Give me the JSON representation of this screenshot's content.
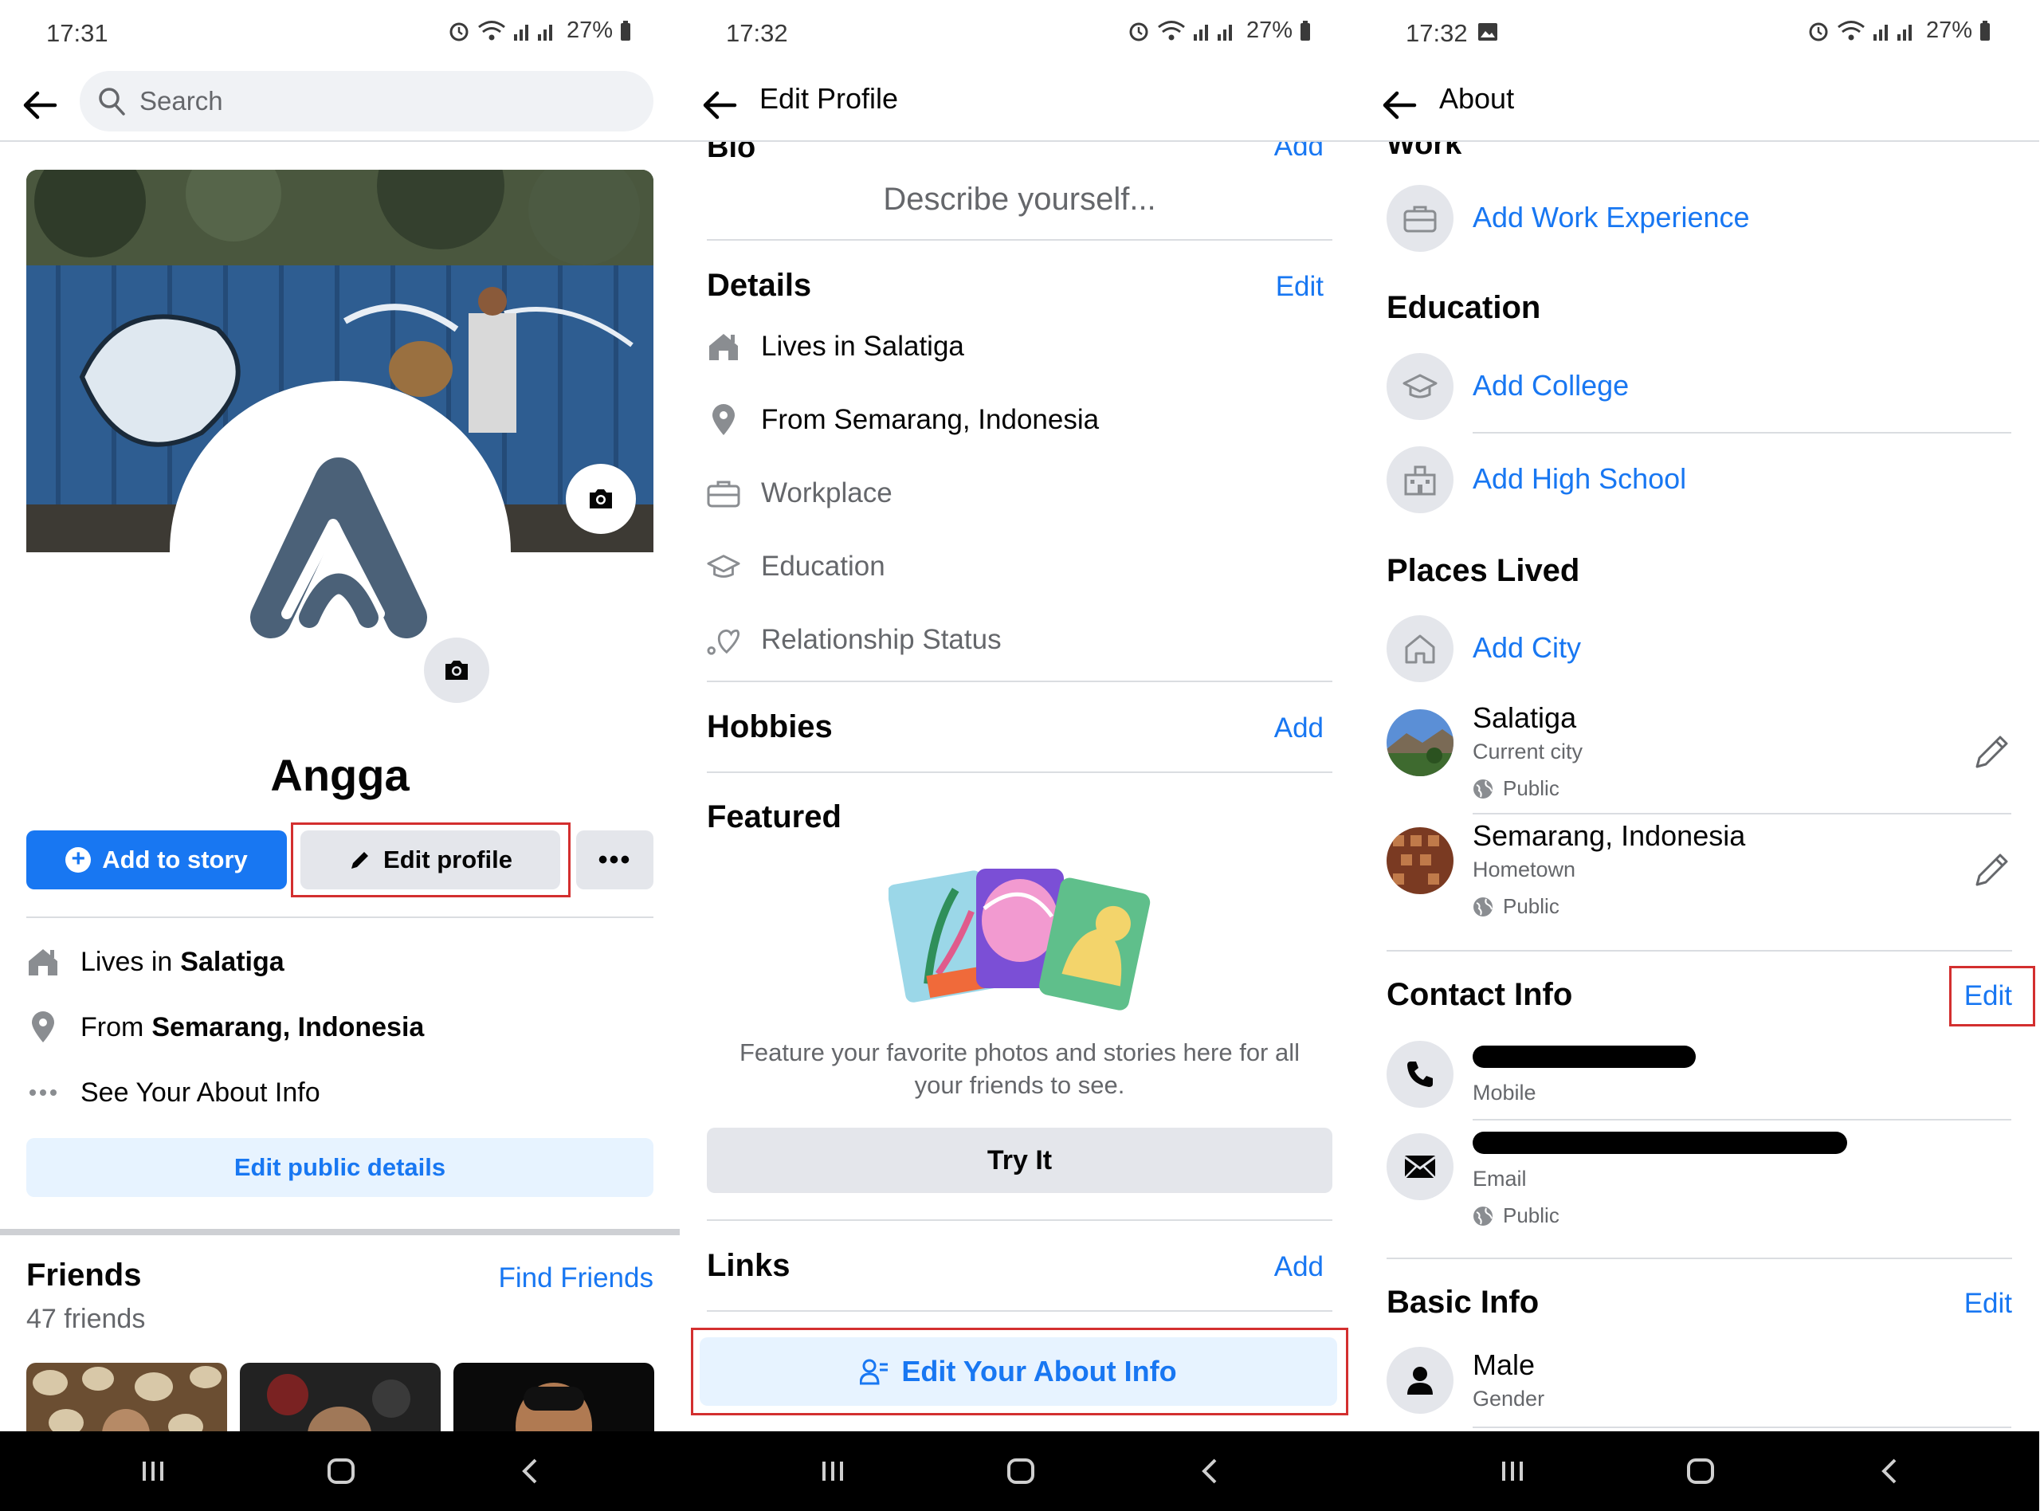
{
  "screen1": {
    "status_time": "17:31",
    "battery": "27%",
    "search_placeholder": "Search",
    "profile_name": "Angga",
    "add_story_label": "Add to story",
    "edit_profile_label": "Edit profile",
    "more_label": "•••",
    "lives_prefix": "Lives in",
    "lives_value": "Salatiga",
    "from_prefix": "From",
    "from_value": "Semarang, Indonesia",
    "see_about": "See Your About Info",
    "edit_public_details": "Edit public details",
    "friends_title": "Friends",
    "find_friends": "Find Friends",
    "friends_count": "47 friends"
  },
  "screen2": {
    "status_time": "17:32",
    "battery": "27%",
    "title": "Edit Profile",
    "bio_cut_title": "Bio",
    "bio_cut_add": "Add",
    "bio_placeholder": "Describe yourself...",
    "details_title": "Details",
    "details_edit": "Edit",
    "details": [
      "Lives in Salatiga",
      "From Semarang, Indonesia",
      "Workplace",
      "Education",
      "Relationship Status"
    ],
    "hobbies_title": "Hobbies",
    "hobbies_add": "Add",
    "featured_title": "Featured",
    "featured_text_1": "Feature your favorite photos and stories here for all",
    "featured_text_2": "your friends to see.",
    "try_it": "Try It",
    "links_title": "Links",
    "links_add": "Add",
    "edit_about": "Edit Your About Info"
  },
  "screen3": {
    "status_time": "17:32",
    "battery": "27%",
    "title": "About",
    "work_cut_title": "Work",
    "add_work": "Add Work Experience",
    "education_title": "Education",
    "add_college": "Add College",
    "add_high_school": "Add High School",
    "places_title": "Places Lived",
    "add_city": "Add City",
    "places": [
      {
        "name": "Salatiga",
        "type": "Current city",
        "privacy": "Public"
      },
      {
        "name": "Semarang, Indonesia",
        "type": "Hometown",
        "privacy": "Public"
      }
    ],
    "contact_title": "Contact Info",
    "contact_edit": "Edit",
    "mobile_label": "Mobile",
    "email_label": "Email",
    "email_privacy": "Public",
    "basic_title": "Basic Info",
    "basic_edit": "Edit",
    "gender_value": "Male",
    "gender_label": "Gender"
  },
  "colors": {
    "accent": "#1877f2",
    "accent_light": "#e7f3ff",
    "button_grey": "#e4e6eb",
    "annotation_red": "#d32f2f",
    "text_secondary": "#65676b"
  }
}
